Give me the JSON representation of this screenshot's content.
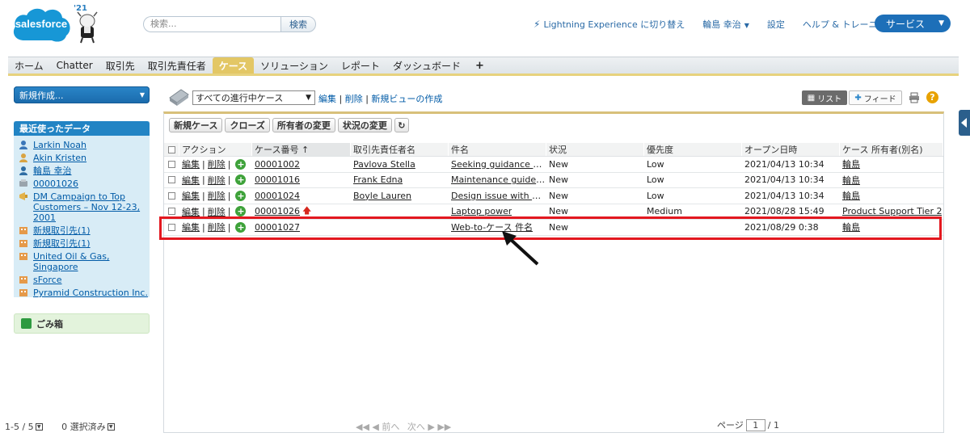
{
  "header": {
    "logo_text": "salesforce",
    "release_badge": "'21",
    "search_placeholder": "検索...",
    "search_button": "検索",
    "lightning_link": "Lightning Experience に切り替え",
    "user_name": "輪島 幸治",
    "setup": "設定",
    "help": "ヘルプ & トレーニング",
    "app_menu": "サービス",
    "colors": {
      "brand_blue": "#1d6fb8",
      "tab_active": "#e3c765"
    }
  },
  "tabs": [
    {
      "label": "ホーム"
    },
    {
      "label": "Chatter"
    },
    {
      "label": "取引先"
    },
    {
      "label": "取引先責任者"
    },
    {
      "label": "ケース",
      "active": true
    },
    {
      "label": "ソリューション"
    },
    {
      "label": "レポート"
    },
    {
      "label": "ダッシュボード"
    },
    {
      "label": "+"
    }
  ],
  "sidebar": {
    "new_create": "新規作成...",
    "recent_title": "最近使ったデータ",
    "recent_items": [
      {
        "label": "Larkin Noah",
        "icon": "contact-icon"
      },
      {
        "label": "Akin Kristen",
        "icon": "lead-icon"
      },
      {
        "label": "輪島 幸治",
        "icon": "user-icon"
      },
      {
        "label": "00001026",
        "icon": "case-icon"
      },
      {
        "label": "DM Campaign to Top Customers – Nov 12-23, 2001",
        "icon": "campaign-icon"
      },
      {
        "label": "新規取引先(1)",
        "icon": "account-icon"
      },
      {
        "label": "新規取引先(1)",
        "icon": "account-icon"
      },
      {
        "label": "United Oil & Gas, Singapore",
        "icon": "account-icon"
      },
      {
        "label": "sForce",
        "icon": "account-icon"
      },
      {
        "label": "Pyramid Construction Inc.",
        "icon": "account-icon"
      }
    ],
    "trash": "ごみ箱"
  },
  "view": {
    "selected": "すべての進行中ケース",
    "edit": "編集",
    "delete": "削除",
    "new_view": "新規ビューの作成",
    "list_label": "リスト",
    "feed_label": "フィード"
  },
  "buttons": {
    "new_case": "新規ケース",
    "close": "クローズ",
    "change_owner": "所有者の変更",
    "change_status": "状況の変更"
  },
  "table": {
    "columns": [
      "アクション",
      "ケース番号 ↑",
      "取引先責任者名",
      "件名",
      "状況",
      "優先度",
      "オープン日時",
      "ケース 所有者(別名)"
    ],
    "action_edit": "編集",
    "action_delete": "削除",
    "rows": [
      {
        "case_no": "00001002",
        "contact": "Pavlova Stella",
        "subject": "Seeking guidance on electrical wiring installation",
        "status": "New",
        "priority": "Low",
        "opened": "2021/04/13 10:34",
        "owner": "輪島",
        "escalated": false
      },
      {
        "case_no": "00001016",
        "contact": "Frank Edna",
        "subject": "Maintenance guidelines for generator unclear",
        "status": "New",
        "priority": "Low",
        "opened": "2021/04/13 10:34",
        "owner": "輪島",
        "escalated": false
      },
      {
        "case_no": "00001024",
        "contact": "Boyle Lauren",
        "subject": "Design issue with mechanical rotor",
        "status": "New",
        "priority": "Low",
        "opened": "2021/04/13 10:34",
        "owner": "輪島",
        "escalated": false
      },
      {
        "case_no": "00001026",
        "contact": "",
        "subject": "Laptop power",
        "status": "New",
        "priority": "Medium",
        "opened": "2021/08/28 15:49",
        "owner": "Product Support Tier 2",
        "escalated": true
      },
      {
        "case_no": "00001027",
        "contact": "",
        "subject": "Web-to-ケース 件名",
        "status": "New",
        "priority": "",
        "opened": "2021/08/29 0:38",
        "owner": "輪島",
        "escalated": false
      }
    ]
  },
  "footer": {
    "range": "1-5 / 5",
    "selected": "0 選択済み",
    "prev": "◀◀ ◀ 前へ",
    "next": "次へ ▶ ▶▶",
    "page_label": "ページ",
    "page_value": "1",
    "page_total": "/ 1"
  }
}
